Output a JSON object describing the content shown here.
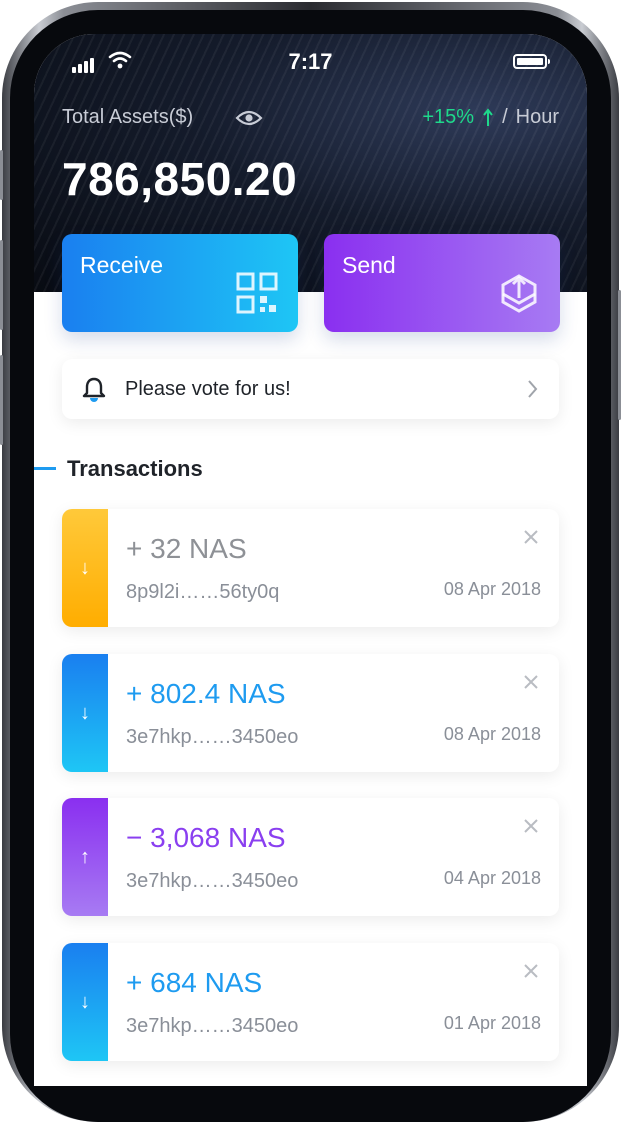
{
  "status": {
    "time": "7:17"
  },
  "header": {
    "total_label": "Total Assets($)",
    "change_pct": "+15%",
    "change_sep": "/",
    "change_period": "Hour",
    "total_value": "786,850.20"
  },
  "actions": {
    "receive_label": "Receive",
    "send_label": "Send"
  },
  "notice": {
    "text": "Please vote for us!"
  },
  "transactions": {
    "title": "Transactions",
    "items": [
      {
        "amount": "+ 32 NAS",
        "address": "8p9l2i……56ty0q",
        "date": "08 Apr 2018",
        "direction": "in",
        "accent": "#ffb300",
        "amount_color": "#8e9196"
      },
      {
        "amount": "+ 802.4 NAS",
        "address": "3e7hkp……3450eo",
        "date": "08 Apr 2018",
        "direction": "in",
        "accent": "#1e9bf0",
        "amount_color": "#1e9bf0"
      },
      {
        "amount": "− 3,068 NAS",
        "address": "3e7hkp……3450eo",
        "date": "04 Apr 2018",
        "direction": "out",
        "accent": "#8a3ff0",
        "amount_color": "#8a3ff0"
      },
      {
        "amount": "+ 684 NAS",
        "address": "3e7hkp……3450eo",
        "date": "01 Apr 2018",
        "direction": "in",
        "accent": "#1e9bf0",
        "amount_color": "#1e9bf0"
      }
    ]
  },
  "colors": {
    "positive": "#1ed98b",
    "receive_gradient": [
      "#1a7ff0",
      "#1ec6f5"
    ],
    "send_gradient": [
      "#8a2ff0",
      "#a77bf3"
    ]
  },
  "icons": [
    "signal-icon",
    "wifi-icon",
    "battery-icon",
    "eye-icon",
    "qr-code-icon",
    "send-box-icon",
    "bell-icon",
    "chevron-right-icon",
    "close-icon",
    "arrow-down-icon",
    "arrow-up-icon"
  ]
}
